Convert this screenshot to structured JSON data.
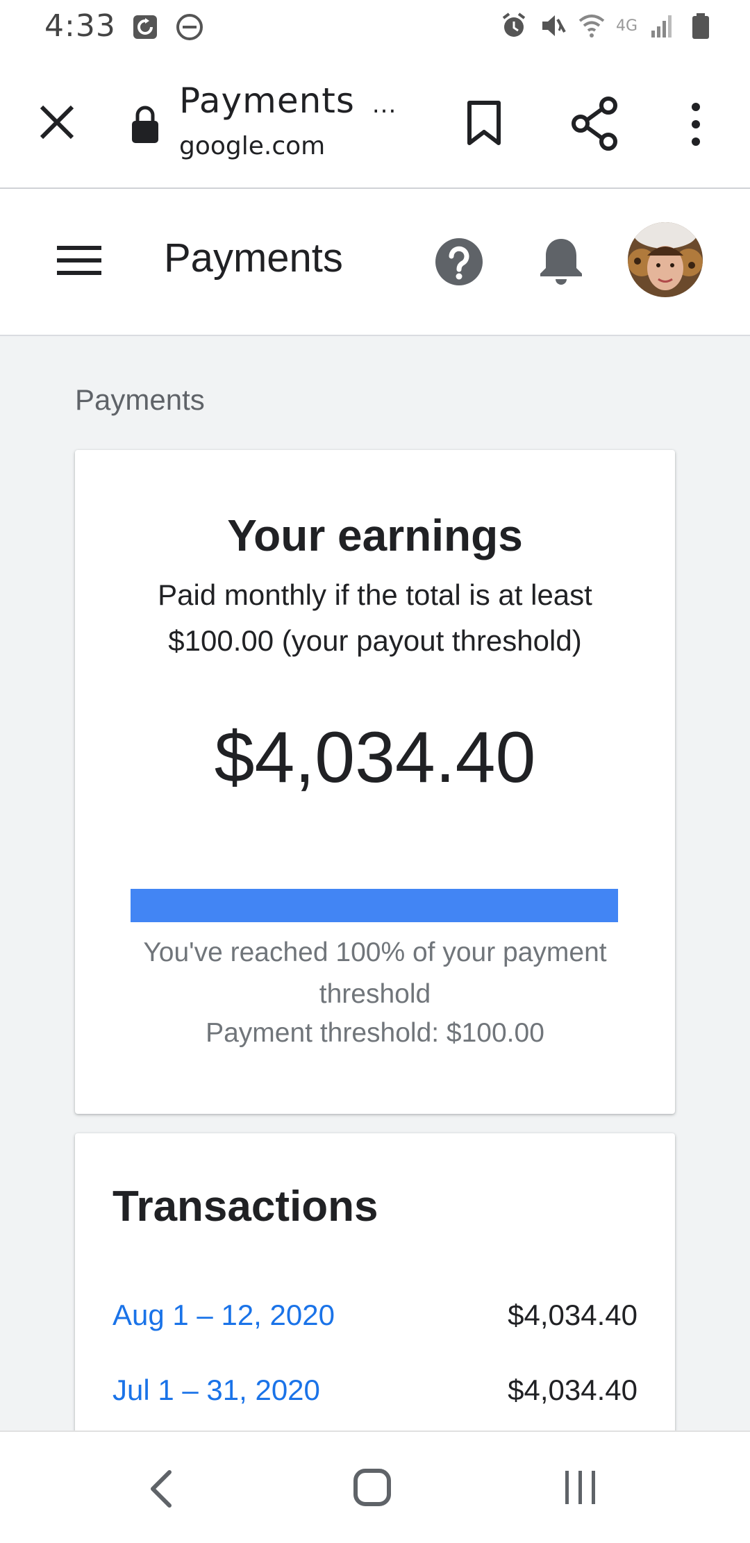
{
  "status_bar": {
    "time": "4:33",
    "network": "4G"
  },
  "browser": {
    "page_title": "Payments",
    "title_dots": "...",
    "url": "google.com"
  },
  "header": {
    "title": "Payments"
  },
  "breadcrumb": "Payments",
  "earnings": {
    "title": "Your earnings",
    "subtitle": "Paid monthly if the total is at least $100.00 (your payout threshold)",
    "amount": "$4,034.40",
    "progress_percent": 100,
    "reached_text": "You've reached 100% of your payment threshold",
    "threshold_text": "Payment threshold: $100.00",
    "progress_color": "#4285f4"
  },
  "transactions": {
    "title": "Transactions",
    "rows": [
      {
        "date": "Aug 1 – 12, 2020",
        "amount": "$4,034.40"
      },
      {
        "date": "Jul 1 – 31, 2020",
        "amount": "$4,034.40"
      }
    ]
  },
  "colors": {
    "link": "#1a73e8",
    "accent": "#4285f4"
  }
}
